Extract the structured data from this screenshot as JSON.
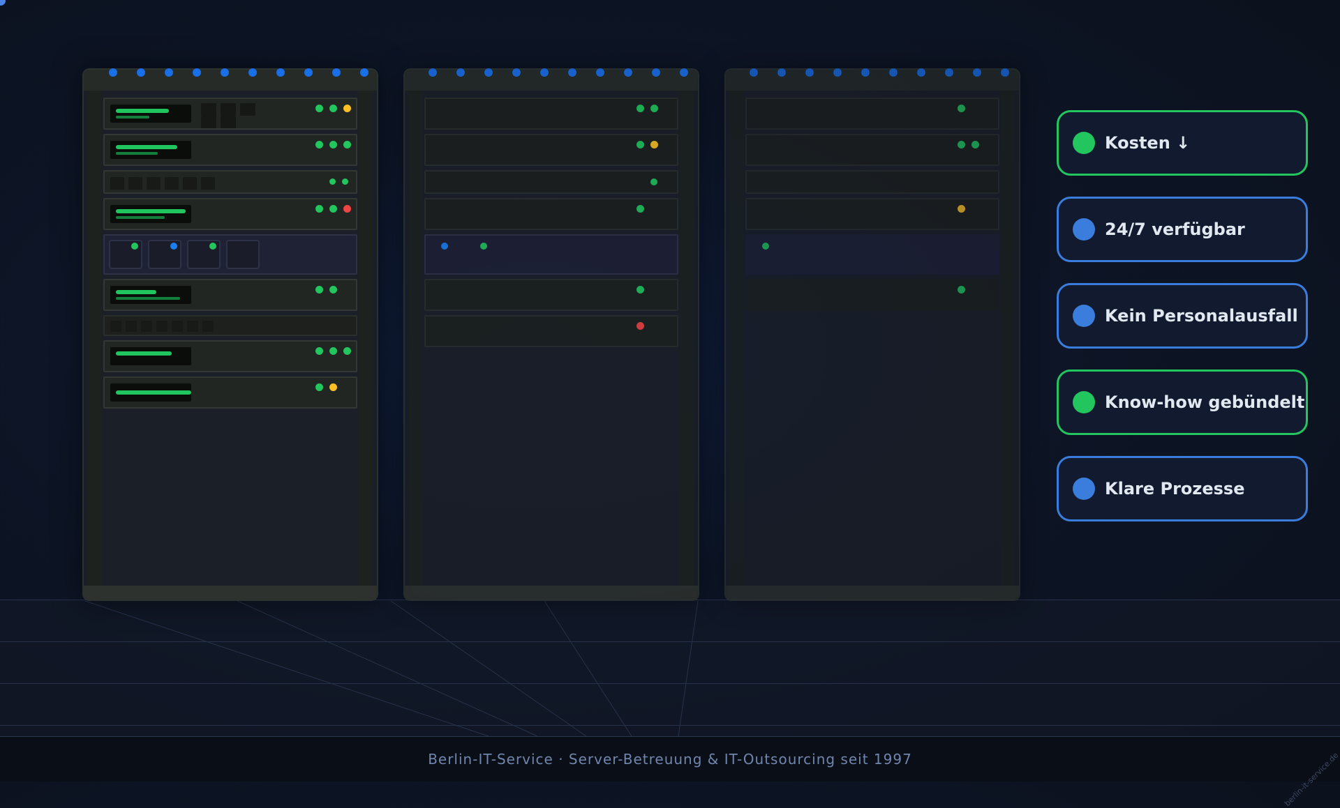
{
  "features": [
    {
      "label": "Kosten ↓",
      "color": "#22c55e"
    },
    {
      "label": "24/7 verfügbar",
      "color": "#3b7ddd"
    },
    {
      "label": "Kein Personalausfall",
      "color": "#3b7ddd"
    },
    {
      "label": "Know-how gebündelt",
      "color": "#22c55e"
    },
    {
      "label": "Klare Prozesse",
      "color": "#3b7ddd"
    }
  ],
  "footer": {
    "text": "Berlin-IT-Service · Server-Betreuung & IT-Outsourcing seit 1997"
  },
  "watermark": {
    "text": "berlin-it-service.de"
  },
  "colors": {
    "led_green": "#22c55e",
    "led_yellow": "#fbbf24",
    "led_red": "#ef4444",
    "bolt_blue": "#1a6fe6"
  },
  "racks": [
    {
      "name": "rack-1",
      "status_leds": [
        [
          "green",
          "green",
          "yellow"
        ],
        [
          "green",
          "green",
          "green"
        ],
        [
          "green",
          "green"
        ],
        [
          "green",
          "green",
          "red"
        ],
        [
          "green",
          "blue",
          "green"
        ],
        [
          "green",
          "green"
        ],
        [],
        [
          "green",
          "green",
          "green"
        ],
        [
          "green",
          "yellow"
        ]
      ]
    },
    {
      "name": "rack-2",
      "status_leds": [
        [
          "green",
          "green"
        ],
        [
          "green",
          "yellow"
        ],
        [
          "green"
        ],
        [
          "green"
        ],
        [
          "blue",
          "green"
        ],
        [
          "green"
        ],
        [
          "red"
        ]
      ]
    },
    {
      "name": "rack-3",
      "status_leds": [
        [
          "green"
        ],
        [
          "green",
          "green"
        ],
        [],
        [
          "yellow"
        ],
        [
          "green"
        ],
        [
          "green"
        ]
      ]
    }
  ]
}
